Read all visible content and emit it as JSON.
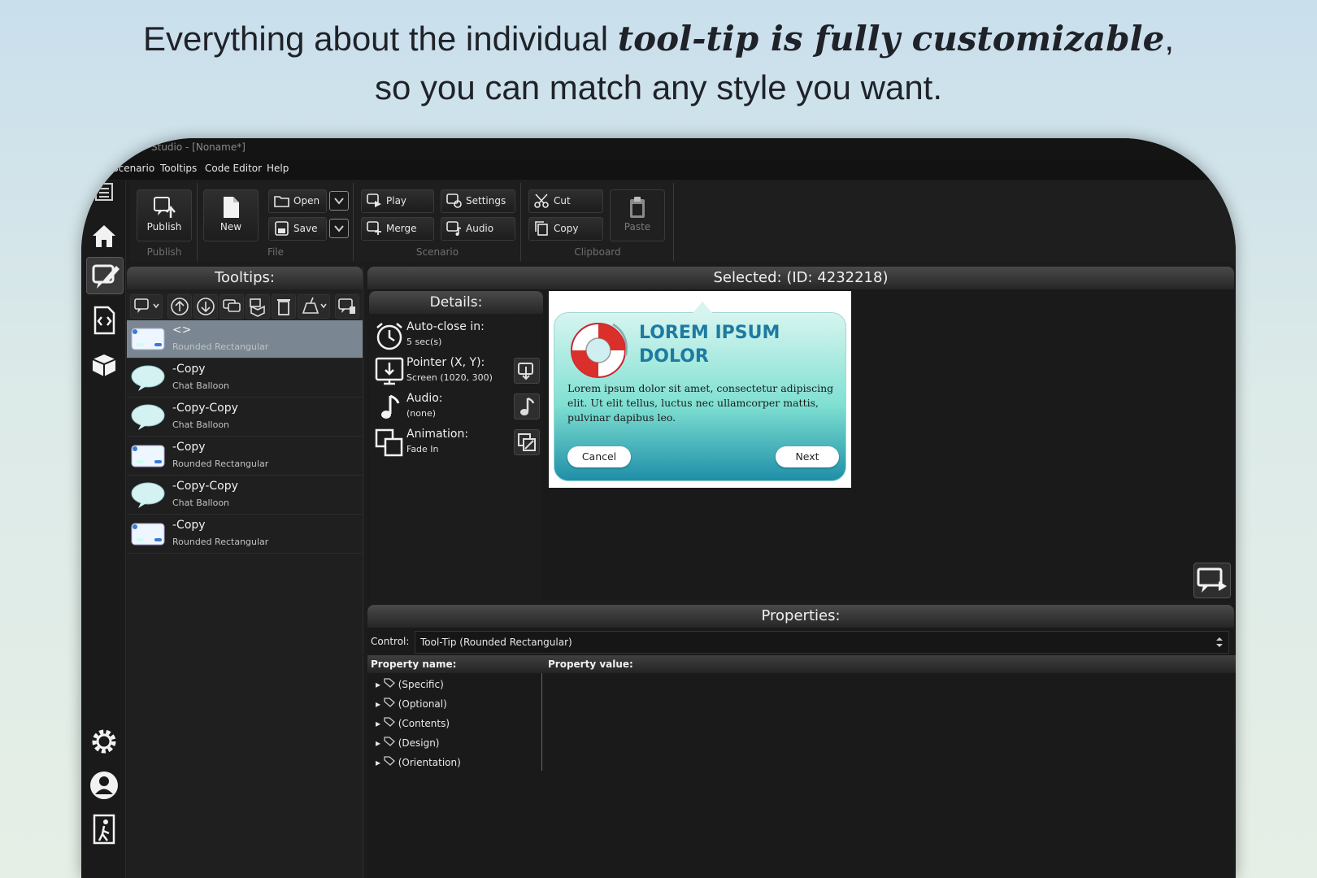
{
  "headline": {
    "line1_prefix": "Everything about the individual ",
    "line1_emphasis": "tool-tip is fully customizable",
    "line1_suffix": ",",
    "line2": "so you can match any style you want."
  },
  "window": {
    "title": "Studio - [Noname*]"
  },
  "menu": [
    "Scenario",
    "Tooltips",
    "Code Editor",
    "Help"
  ],
  "ribbon": {
    "publish": {
      "button": "Publish",
      "group": "Publish"
    },
    "file": {
      "new": "New",
      "open": "Open",
      "save": "Save",
      "group": "File"
    },
    "scenario": {
      "play": "Play",
      "settings": "Settings",
      "merge": "Merge",
      "audio": "Audio",
      "group": "Scenario"
    },
    "clipboard": {
      "cut": "Cut",
      "copy": "Copy",
      "paste": "Paste",
      "group": "Clipboard"
    }
  },
  "tooltips_panel": {
    "title": "Tooltips:",
    "items": [
      {
        "name": "<>",
        "kind": "Rounded Rectangular",
        "selected": true
      },
      {
        "name": "-Copy",
        "kind": "Chat Balloon"
      },
      {
        "name": "-Copy-Copy",
        "kind": "Chat Balloon"
      },
      {
        "name": "-Copy",
        "kind": "Rounded Rectangular"
      },
      {
        "name": "-Copy-Copy",
        "kind": "Chat Balloon"
      },
      {
        "name": "-Copy",
        "kind": "Rounded Rectangular"
      }
    ]
  },
  "selected": {
    "title": "Selected:  (ID: 4232218)"
  },
  "details": {
    "title": "Details:",
    "autoclose": {
      "label": "Auto-close in:",
      "value": "5 sec(s)"
    },
    "pointer": {
      "label": "Pointer (X, Y):",
      "value": "Screen (1020, 300)"
    },
    "audio": {
      "label": "Audio:",
      "value": "(none)"
    },
    "animation": {
      "label": "Animation:",
      "value": "Fade In"
    }
  },
  "preview": {
    "title_line1": "LOREM IPSUM",
    "title_line2": "DOLOR",
    "body": "Lorem ipsum dolor sit amet, consectetur adipiscing elit. Ut elit tellus, luctus nec ullamcorper mattis, pulvinar dapibus leo.",
    "cancel": "Cancel",
    "next": "Next"
  },
  "properties": {
    "title": "Properties:",
    "control_label": "Control:",
    "control_value": "Tool-Tip (Rounded Rectangular)",
    "col_name": "Property name:",
    "col_value": "Property value:",
    "rows": [
      "(Specific)",
      "(Optional)",
      "(Contents)",
      "(Design)",
      "(Orientation)"
    ]
  },
  "colors": {
    "accent": "#1e7aa0",
    "selected_row": "#7a8792",
    "app_bg": "#1c1c1c"
  }
}
